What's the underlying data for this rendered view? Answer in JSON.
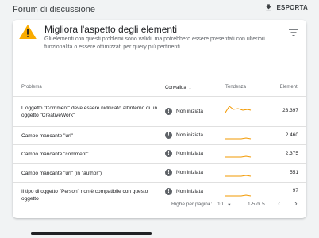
{
  "app": {
    "title": "Forum di discussione",
    "export_label": "ESPORTA"
  },
  "section": {
    "heading": "Migliora l'aspetto degli elementi",
    "description": "Gli elementi con questi problemi sono validi, ma potrebbero essere presentati con ulteriori funzionalità o essere ottimizzati per query più pertinenti"
  },
  "table": {
    "columns": {
      "problem": "Problema",
      "validation": "Convalida",
      "trend": "Tendenza",
      "items": "Elementi"
    },
    "rows": [
      {
        "problem": "L'oggetto \"Comment\" deve essere nidificato all'interno di un oggetto \"CreativeWork\"",
        "status": "Non iniziata",
        "count": "23.397"
      },
      {
        "problem": "Campo mancante \"url\"",
        "status": "Non iniziata",
        "count": "2.460"
      },
      {
        "problem": "Campo mancante \"comment\"",
        "status": "Non iniziata",
        "count": "2.375"
      },
      {
        "problem": "Campo mancante \"url\" (in \"author\")",
        "status": "Non iniziata",
        "count": "551"
      },
      {
        "problem": "Il tipo di oggetto \"Person\" non è compatibile con questo oggetto",
        "status": "Non iniziata",
        "count": "97"
      }
    ]
  },
  "pagination": {
    "rows_per_page_label": "Righe per pagina:",
    "rows_per_page": "10",
    "range": "1-5 di 5"
  },
  "colors": {
    "warning": "#f9ab00",
    "trend_line": "#f29900",
    "status_dot": "#5f6368"
  },
  "icons": {
    "export": "download-icon",
    "warning": "warning-icon",
    "filter": "filter-icon",
    "status": "error-icon"
  }
}
